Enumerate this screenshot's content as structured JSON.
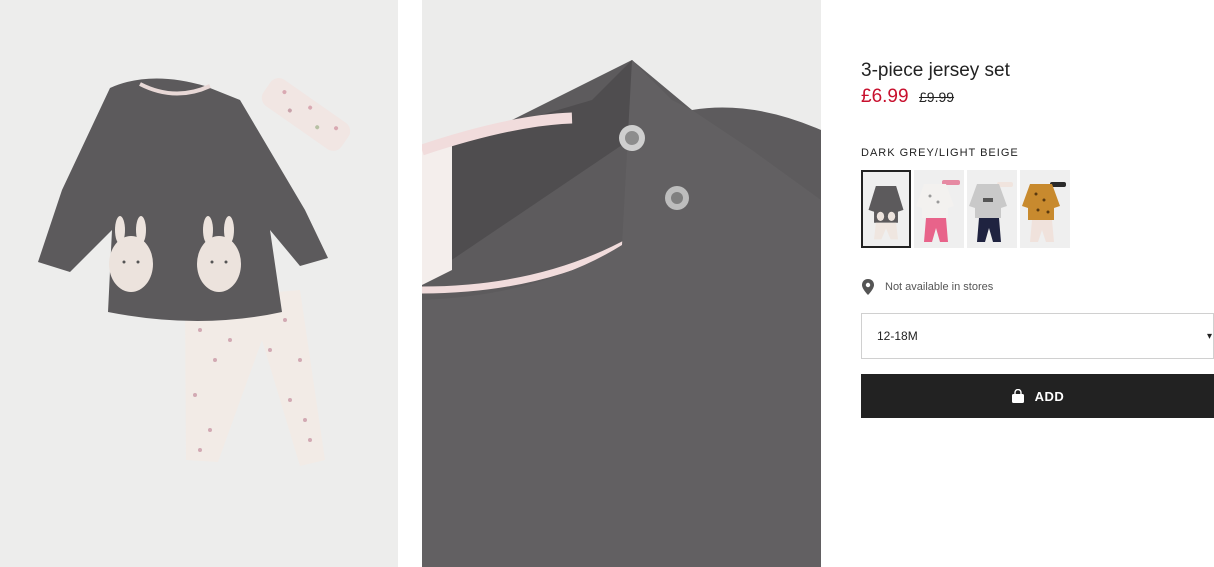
{
  "product": {
    "title": "3-piece jersey set",
    "price_current": "£6.99",
    "price_original": "£9.99"
  },
  "color": {
    "selected_label": "DARK GREY/LIGHT BEIGE",
    "swatches": [
      {
        "name": "dark grey set",
        "selected": true
      },
      {
        "name": "white floral set with pink leggings"
      },
      {
        "name": "grey set with navy leggings"
      },
      {
        "name": "ochre leopard set"
      }
    ]
  },
  "availability": {
    "text": "Not available in stores",
    "icon": "location-pin-icon"
  },
  "size": {
    "selected": "12-18M",
    "icon": "caret-down-icon"
  },
  "add_button": {
    "label": "ADD",
    "icon": "shopping-bag-icon"
  },
  "colors": {
    "sale_price": "#c8102e",
    "button_bg": "#222222",
    "text": "#222222"
  }
}
